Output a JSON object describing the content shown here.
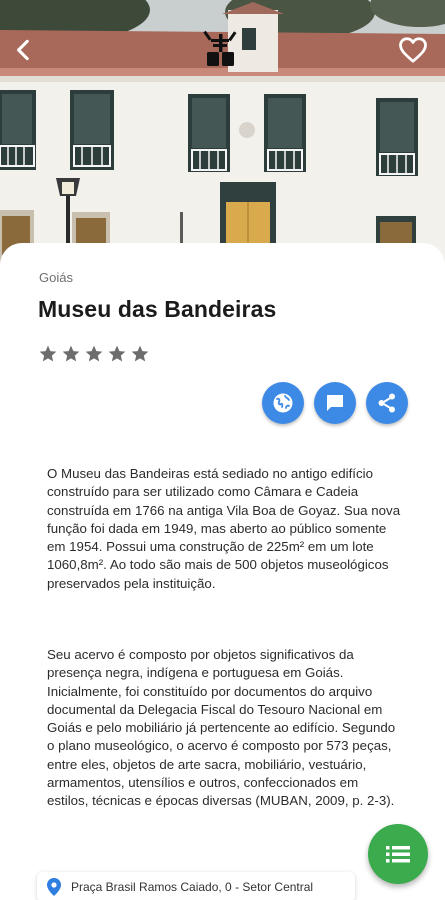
{
  "place": {
    "region": "Goiás",
    "name": "Museu das Bandeiras",
    "rating_stars_filled": 0,
    "rating_stars_total": 5
  },
  "description": {
    "paragraph_1": "O Museu das Bandeiras está sediado no antigo edifício construído para ser utilizado como Câmara e Cadeia construída em 1766 na antiga Vila Boa de Goyaz. Sua nova função foi dada em 1949, mas aberto ao público somente em 1954. Possui uma construção de 225m² em um lote 1060,8m². Ao todo são mais de 500 objetos museológicos preservados pela instituição.",
    "paragraph_2": "Seu acervo é composto por objetos significativos da presença negra, indígena e portuguesa em Goiás. Inicialmente, foi constituído por documentos do arquivo documental da Delegacia Fiscal do Tesouro Nacional em Goiás e pelo mobiliário já pertencente ao edifício. Segundo o plano museológico, o acervo é composto por 573 peças, entre eles, objetos de arte sacra, mobiliário, vestuário, armamentos, utensílios e outros, confeccionados em estilos, técnicas e épocas diversas (MUBAN, 2009, p. 2-3)."
  },
  "address": {
    "text": "Praça Brasil Ramos Caiado, 0 - Setor Central"
  },
  "icons": {
    "back": "arrow-back-icon",
    "favorite": "heart-outline-icon",
    "logo": "app-logo-icon",
    "website": "globe-icon",
    "comments": "chat-bubble-icon",
    "share": "share-icon",
    "location": "location-pin-icon",
    "menu": "list-icon"
  },
  "colors": {
    "action_blue": "#3d8ae6",
    "fab_green": "#3bab4d",
    "star_grey": "#6d6d6d",
    "pin_blue": "#2f7fe0"
  }
}
